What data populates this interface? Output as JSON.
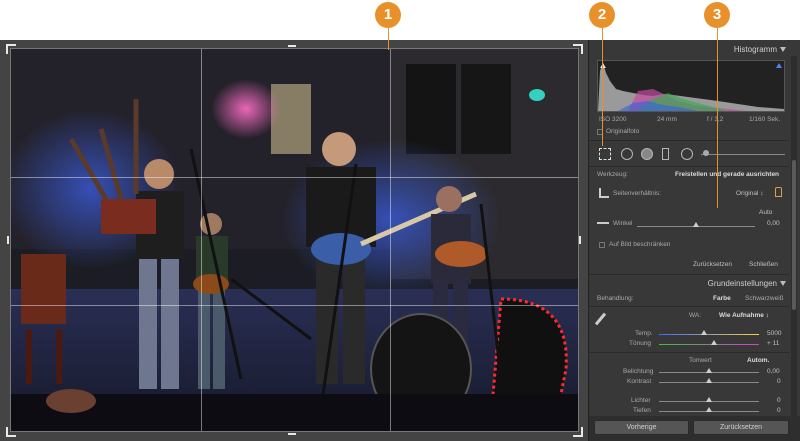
{
  "callouts": [
    "1",
    "2",
    "3"
  ],
  "histogram": {
    "title": "Histogramm",
    "iso": "ISO 3200",
    "focal": "24 mm",
    "aperture": "f / 3,2",
    "shutter": "1/160 Sek.",
    "original_photo_label": "Originalfoto"
  },
  "crop": {
    "tool_label": "Werkzeug:",
    "tool_title": "Freistellen und gerade ausrichten",
    "aspect_label": "Seitenverhältnis:",
    "aspect_value": "Original ↕",
    "auto_label": "Auto",
    "angle_label": "Winkel",
    "angle_value": "0,00",
    "angle_position": 0.5,
    "constrain_label": "Auf Bild beschränken",
    "reset_label": "Zurücksetzen",
    "close_label": "Schließen"
  },
  "basic": {
    "title": "Grundeinstellungen",
    "treatment_label": "Behandlung:",
    "treatment_color": "Farbe",
    "treatment_bw": "Schwarzweiß",
    "wb_label": "WA:",
    "wb_value": "Wie Aufnahme ↕",
    "temp_label": "Temp.",
    "temp_value": "5000",
    "temp_position": 0.45,
    "tint_label": "Tönung",
    "tint_value": "+ 11",
    "tint_position": 0.55,
    "tone_label": "Tonwert",
    "tone_auto": "Autom.",
    "exposure_label": "Belichtung",
    "exposure_value": "0,00",
    "exposure_position": 0.5,
    "contrast_label": "Kontrast",
    "contrast_value": "0",
    "contrast_position": 0.5,
    "highlights_label": "Lichter",
    "highlights_value": "0",
    "highlights_position": 0.5,
    "shadows_label": "Tiefen",
    "shadows_value": "0",
    "shadows_position": 0.5
  },
  "bottom": {
    "previous_button": "Vorherige",
    "reset_button": "Zurücksetzen"
  },
  "colors": {
    "accent": "#e8912a",
    "panel_bg": "#383838",
    "canvas_bg": "#444444"
  }
}
